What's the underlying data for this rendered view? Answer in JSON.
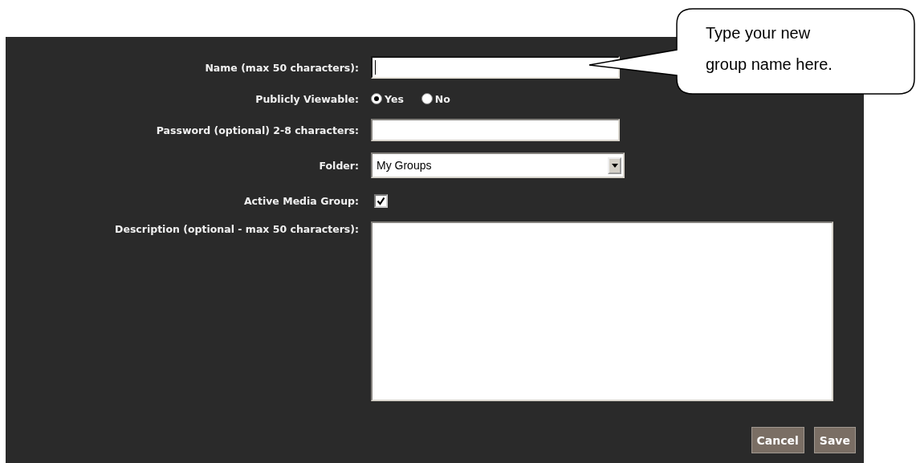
{
  "form": {
    "fields": [
      {
        "kind": "text",
        "label": "Name (max 50 characters):",
        "focused": true
      },
      {
        "kind": "radio",
        "label": "Publicly Viewable:",
        "options": [
          {
            "label": "Yes",
            "selected": true
          },
          {
            "label": "No",
            "selected": false
          }
        ]
      },
      {
        "kind": "text",
        "label": "Password (optional) 2-8 characters:",
        "focused": false
      },
      {
        "kind": "select",
        "label": "Folder:",
        "value": "My Groups"
      },
      {
        "kind": "checkbox",
        "label": "Active Media Group:",
        "checked": true
      },
      {
        "kind": "textarea",
        "label": "Description (optional - max 50 characters):"
      }
    ],
    "buttons": [
      "Cancel",
      "Save"
    ]
  },
  "callout": {
    "text": "Type your new group name here."
  }
}
